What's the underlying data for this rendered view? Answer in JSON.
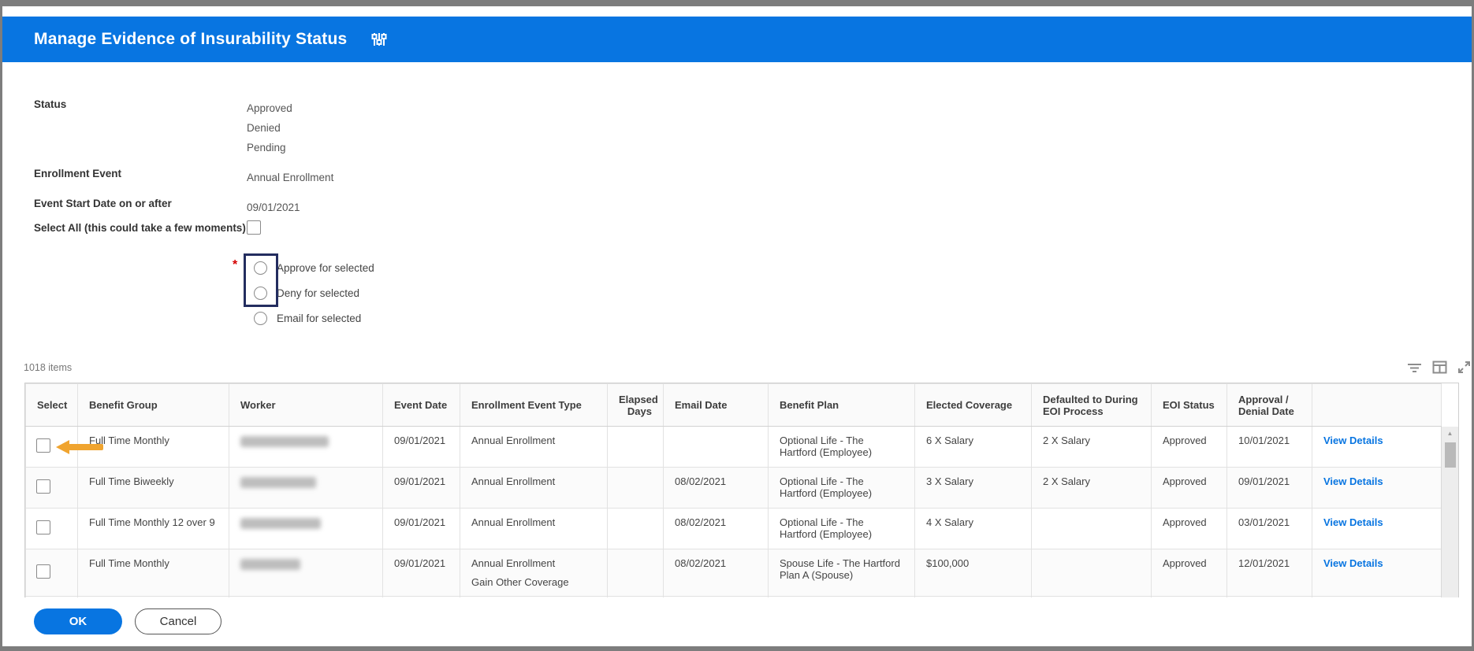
{
  "header": {
    "title": "Manage Evidence of Insurability Status",
    "icon": "sliders-icon"
  },
  "filters": {
    "status": {
      "label": "Status",
      "values": [
        "Approved",
        "Denied",
        "Pending"
      ]
    },
    "enrollment_event": {
      "label": "Enrollment Event",
      "value": "Annual Enrollment"
    },
    "event_start_date": {
      "label": "Event Start Date on or after",
      "value": "09/01/2021"
    },
    "select_all": {
      "label": "Select All (this could take a few moments)",
      "checked": false
    }
  },
  "radio_group": {
    "required_marker": "*",
    "options": [
      {
        "label": "Approve for selected",
        "selected": false
      },
      {
        "label": "Deny for selected",
        "selected": false
      },
      {
        "label": "Email for selected",
        "selected": false
      }
    ],
    "highlight_color": "#232d5f"
  },
  "table": {
    "items_count": "1018 items",
    "toolbar_icons": [
      "filter-icon",
      "grid-icon",
      "expand-icon"
    ],
    "columns": [
      "Select",
      "Benefit Group",
      "Worker",
      "Event Date",
      "Enrollment Event Type",
      "Elapsed Days",
      "Email Date",
      "Benefit Plan",
      "Elected Coverage",
      "Defaulted to During EOI Process",
      "EOI Status",
      "Approval / Denial Date",
      ""
    ],
    "rows": [
      {
        "benefit_group": "Full Time Monthly",
        "worker": "",
        "event_date": "09/01/2021",
        "event_type": "Annual Enrollment",
        "event_type2": "",
        "elapsed_days": "",
        "email_date": "",
        "benefit_plan": "Optional Life - The Hartford (Employee)",
        "elected_coverage": "6 X Salary",
        "defaulted": "2 X Salary",
        "eoi_status": "Approved",
        "approval_date": "10/01/2021",
        "action": "View Details"
      },
      {
        "benefit_group": "Full Time Biweekly",
        "worker": "",
        "event_date": "09/01/2021",
        "event_type": "Annual Enrollment",
        "event_type2": "",
        "elapsed_days": "",
        "email_date": "08/02/2021",
        "benefit_plan": "Optional Life - The Hartford (Employee)",
        "elected_coverage": "3 X Salary",
        "defaulted": "2 X Salary",
        "eoi_status": "Approved",
        "approval_date": "09/01/2021",
        "action": "View Details"
      },
      {
        "benefit_group": "Full Time Monthly 12 over 9",
        "worker": "",
        "event_date": "09/01/2021",
        "event_type": "Annual Enrollment",
        "event_type2": "",
        "elapsed_days": "",
        "email_date": "08/02/2021",
        "benefit_plan": "Optional Life - The Hartford (Employee)",
        "elected_coverage": "4 X Salary",
        "defaulted": "",
        "eoi_status": "Approved",
        "approval_date": "03/01/2021",
        "action": "View Details"
      },
      {
        "benefit_group": "Full Time Monthly",
        "worker": "",
        "event_date": "09/01/2021",
        "event_type": "Annual Enrollment",
        "event_type2": "Gain Other Coverage",
        "elapsed_days": "",
        "email_date": "08/02/2021",
        "benefit_plan": "Spouse Life - The Hartford Plan A (Spouse)",
        "elected_coverage": "$100,000",
        "defaulted": "",
        "eoi_status": "Approved",
        "approval_date": "12/01/2021",
        "action": "View Details"
      }
    ]
  },
  "annotations": {
    "arrow_color": "#f0a42f",
    "arrow_target": "first-row-select-checkbox"
  },
  "footer": {
    "ok_label": "OK",
    "cancel_label": "Cancel"
  }
}
